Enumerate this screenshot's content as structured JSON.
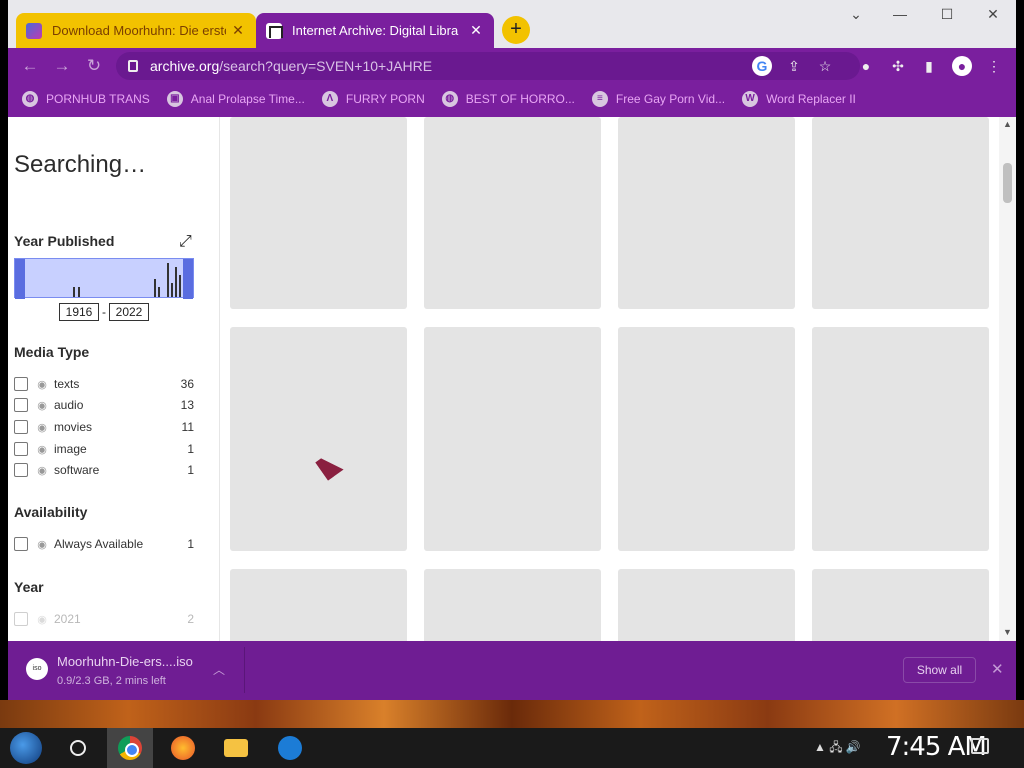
{
  "browser": {
    "tabs": [
      {
        "title": "Download Moorhuhn: Die erste",
        "active": false
      },
      {
        "title": "Internet Archive: Digital Libra",
        "active": true
      }
    ],
    "new_tab": "+",
    "window_controls": {
      "minimize": "—",
      "maximize": "☐",
      "close": "✕",
      "dropdown": "⌄"
    },
    "address": {
      "host": "archive.org",
      "path": "/search?query=SVEN+10+JAHRE"
    },
    "bookmarks": [
      {
        "label": "PORNHUB TRANS",
        "icon": "globe-icon"
      },
      {
        "label": "Anal Prolapse Time...",
        "icon": "bookmark-icon"
      },
      {
        "label": "FURRY PORN",
        "icon": "lambda-icon"
      },
      {
        "label": "BEST OF HORRO...",
        "icon": "globe-icon"
      },
      {
        "label": "Free Gay Porn Vid...",
        "icon": "stack-icon"
      },
      {
        "label": "Word Replacer II",
        "icon": "wr-icon"
      }
    ]
  },
  "sidebar": {
    "status": "Searching…",
    "year_published": {
      "heading": "Year Published",
      "from": "1916",
      "to": "2022",
      "separator": "-"
    },
    "media_type": {
      "heading": "Media Type",
      "items": [
        {
          "label": "texts",
          "count": "36"
        },
        {
          "label": "audio",
          "count": "13"
        },
        {
          "label": "movies",
          "count": "11"
        },
        {
          "label": "image",
          "count": "1"
        },
        {
          "label": "software",
          "count": "1"
        }
      ]
    },
    "availability": {
      "heading": "Availability",
      "items": [
        {
          "label": "Always Available",
          "count": "1"
        }
      ]
    },
    "year": {
      "heading": "Year",
      "items": [
        {
          "label": "2021",
          "count": "2"
        }
      ]
    }
  },
  "download": {
    "filename": "Moorhuhn-Die-ers....iso",
    "status": "0.9/2.3 GB, 2 mins left",
    "icon_text": "iso",
    "show_all": "Show all",
    "close": "✕"
  },
  "taskbar": {
    "clock": "7:45 AM",
    "tray": "▲ 🖧 🔊"
  },
  "colors": {
    "theme": "#7a1f9e",
    "active_tab": "#7a1f9e",
    "inactive_tab": "#f2c200",
    "bookmark_text": "#e8a6f4"
  }
}
